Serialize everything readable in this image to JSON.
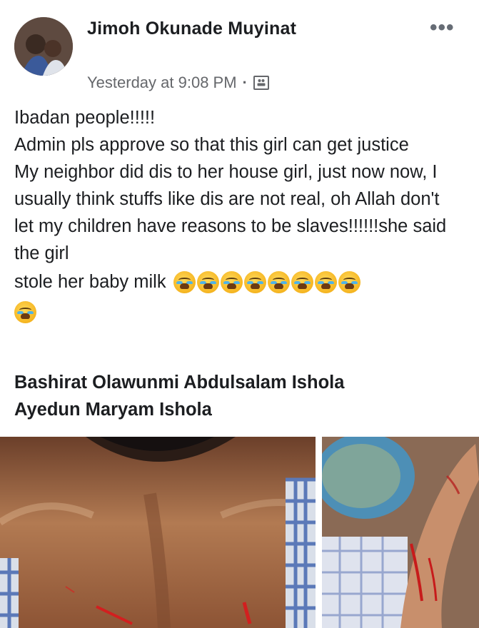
{
  "post": {
    "author": "Jimoh Okunade Muyinat",
    "timestamp": "Yesterday at 9:08 PM",
    "audience_icon": "group-icon",
    "more_icon": "more-options-icon",
    "lines": [
      "Ibadan people!!!!!",
      "Admin pls approve so that this girl can get justice",
      "My neighbor did dis to her house girl, just now now, I usually think stuffs like dis are not real, oh Allah don't let my children have reasons  to be slaves!!!!!!she said the girl"
    ],
    "last_line": "stole her baby milk",
    "emoji_name": "loudly-crying-face-emoji",
    "emoji_count": 9,
    "tags": [
      "Bashirat Olawunmi Abdulsalam Ishola",
      "Ayedun Maryam Ishola"
    ]
  },
  "colors": {
    "text": "#1c1e21",
    "meta": "#65676b",
    "background": "#ffffff"
  }
}
